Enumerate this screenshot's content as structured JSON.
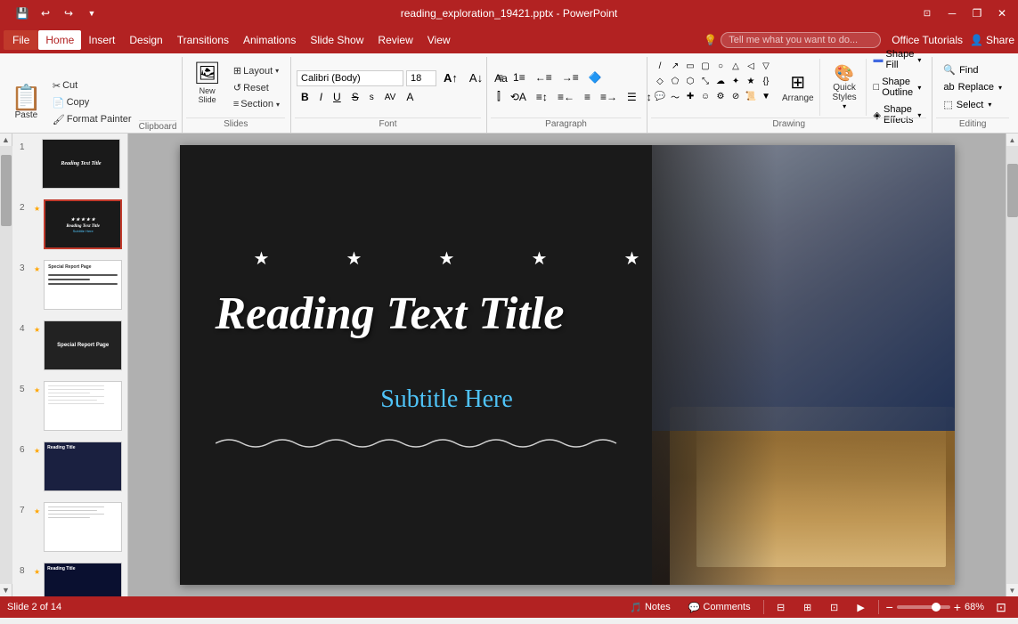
{
  "titlebar": {
    "title": "reading_exploration_19421.pptx - PowerPoint",
    "save_icon": "💾",
    "undo_icon": "↩",
    "redo_icon": "↪",
    "customize_icon": "▼",
    "minimize_icon": "─",
    "restore_icon": "❐",
    "close_icon": "✕",
    "restore2_icon": "⊡"
  },
  "menu": {
    "file_label": "File",
    "items": [
      "Home",
      "Insert",
      "Design",
      "Transitions",
      "Animations",
      "Slide Show",
      "Review",
      "View"
    ],
    "active_item": "Home",
    "search_placeholder": "Tell me what you want to do...",
    "help_label": "Office Tutorials",
    "share_label": "Share"
  },
  "ribbon": {
    "clipboard": {
      "label": "Clipboard",
      "paste_label": "Paste",
      "cut_label": "Cut",
      "copy_label": "Copy",
      "format_painter_label": "Format Painter",
      "expand_icon": "⊞"
    },
    "slides": {
      "label": "Slides",
      "new_slide_label": "New\nSlide",
      "layout_label": "Layout",
      "reset_label": "Reset",
      "section_label": "Section"
    },
    "font": {
      "label": "Font",
      "font_name": "Calibri (Body)",
      "font_size": "18",
      "bold": "B",
      "italic": "I",
      "underline": "U",
      "strikethrough": "S",
      "shadow": "s",
      "expand_icon": "⊞"
    },
    "paragraph": {
      "label": "Paragraph",
      "expand_icon": "⊞"
    },
    "drawing": {
      "label": "Drawing",
      "arrange_label": "Arrange",
      "quick_styles_label": "Quick\nStyles",
      "shape_fill_label": "Shape Fill",
      "shape_outline_label": "Shape Outline",
      "shape_effects_label": "Shape Effects",
      "expand_icon": "⊞"
    },
    "editing": {
      "label": "Editing",
      "find_label": "Find",
      "replace_label": "Replace",
      "select_label": "Select"
    }
  },
  "slides": [
    {
      "num": "1",
      "has_star": false,
      "style": "dark"
    },
    {
      "num": "2",
      "has_star": true,
      "style": "dark",
      "active": true
    },
    {
      "num": "3",
      "has_star": true,
      "style": "light"
    },
    {
      "num": "4",
      "has_star": true,
      "style": "light"
    },
    {
      "num": "5",
      "has_star": true,
      "style": "light"
    },
    {
      "num": "6",
      "has_star": true,
      "style": "dark-blue"
    },
    {
      "num": "7",
      "has_star": true,
      "style": "light"
    },
    {
      "num": "8",
      "has_star": true,
      "style": "dark-blue"
    }
  ],
  "slide": {
    "title": "Reading Text Title",
    "subtitle": "Subtitle Here",
    "stars": [
      "★",
      "★",
      "★",
      "★",
      "★"
    ],
    "wave": "〜〜〜〜〜〜〜〜〜〜〜〜〜〜〜〜〜〜〜〜〜〜〜〜"
  },
  "statusbar": {
    "slide_info": "Slide 2 of 14",
    "notes_label": "Notes",
    "comments_label": "Comments",
    "zoom_level": "68%",
    "normal_icon": "⊟",
    "outline_icon": "⊞",
    "slide_sorter_icon": "⊡",
    "reading_icon": "📖",
    "slideshow_icon": "▶"
  }
}
